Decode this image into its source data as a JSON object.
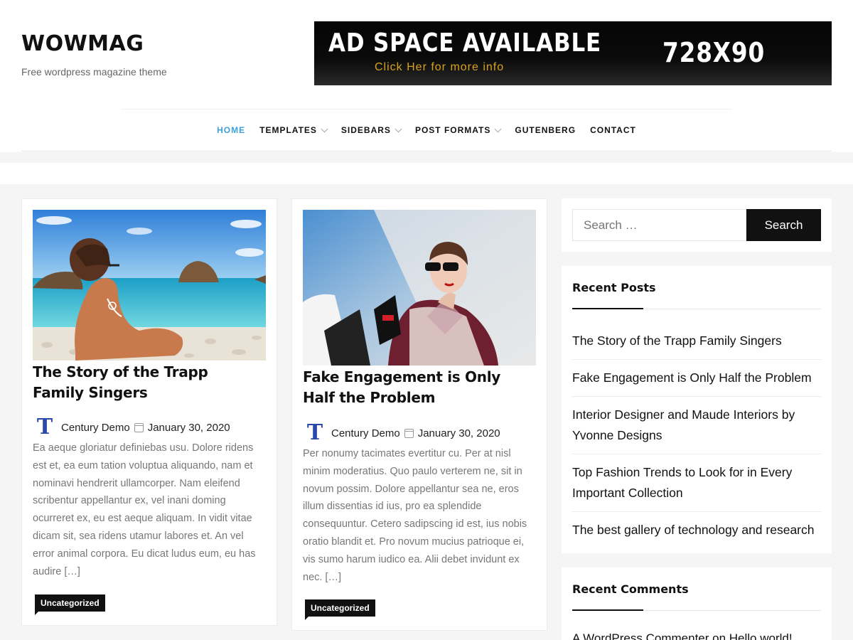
{
  "site": {
    "title": "WOWMAG",
    "tagline": "Free wordpress magazine theme"
  },
  "ad": {
    "headline": "AD SPACE AVAILABLE",
    "subline": "Click Her for more info",
    "size": "728X90"
  },
  "nav": {
    "items": [
      {
        "label": "HOME"
      },
      {
        "label": "TEMPLATES"
      },
      {
        "label": "SIDEBARS"
      },
      {
        "label": "POST FORMATS"
      },
      {
        "label": "GUTENBERG"
      },
      {
        "label": "CONTACT"
      }
    ]
  },
  "posts": [
    {
      "title": "The Story of the Trapp Family Singers",
      "author": "Century Demo",
      "date": "January 30, 2020",
      "excerpt": "Ea aeque gloriatur definiebas usu. Dolore ridens est et, ea eum tation voluptua aliquando, nam et nominavi hendrerit ullamcorper. Nam eleifend scribentur appellantur ex, vel inani doming ocurreret ex, eu est aeque aliquam. In vidit vitae dicam sit, sea ridens utamur labores et. An vel error animal corpora. Eu dicat ludus eum, eu has audire […]",
      "category": "Uncategorized"
    },
    {
      "title": "Fake Engagement is Only Half the Problem",
      "author": "Century Demo",
      "date": "January 30, 2020",
      "excerpt": "Per nonumy tacimates evertitur cu. Per at nisl minim moderatius. Quo paulo verterem ne, sit in novum possim. Dolore appellantur sea ne, eros illum dissentias id ius, pro ea splendide consequuntur. Cetero sadipscing id est, ius nobis oratio blandit et. Pro novum mucius patrioque ei, vis sumo harum iudico ea. Alii debet invidunt ex nec. […]",
      "category": "Uncategorized"
    }
  ],
  "sidebar": {
    "search": {
      "placeholder": "Search …",
      "button": "Search"
    },
    "recent_posts": {
      "title": "Recent Posts",
      "items": [
        "The Story of the Trapp Family Singers",
        "Fake Engagement is Only Half the Problem",
        "Interior Designer and Maude Interiors by Yvonne Designs",
        "Top Fashion Trends to Look for in Every Important Collection",
        "The best gallery of technology and research"
      ]
    },
    "recent_comments": {
      "title": "Recent Comments",
      "first": "A WordPress Commenter on Hello world!"
    }
  },
  "colors": {
    "accent": "#3ea2d8",
    "dark": "#111111",
    "ad_gold": "#d9a21c"
  }
}
